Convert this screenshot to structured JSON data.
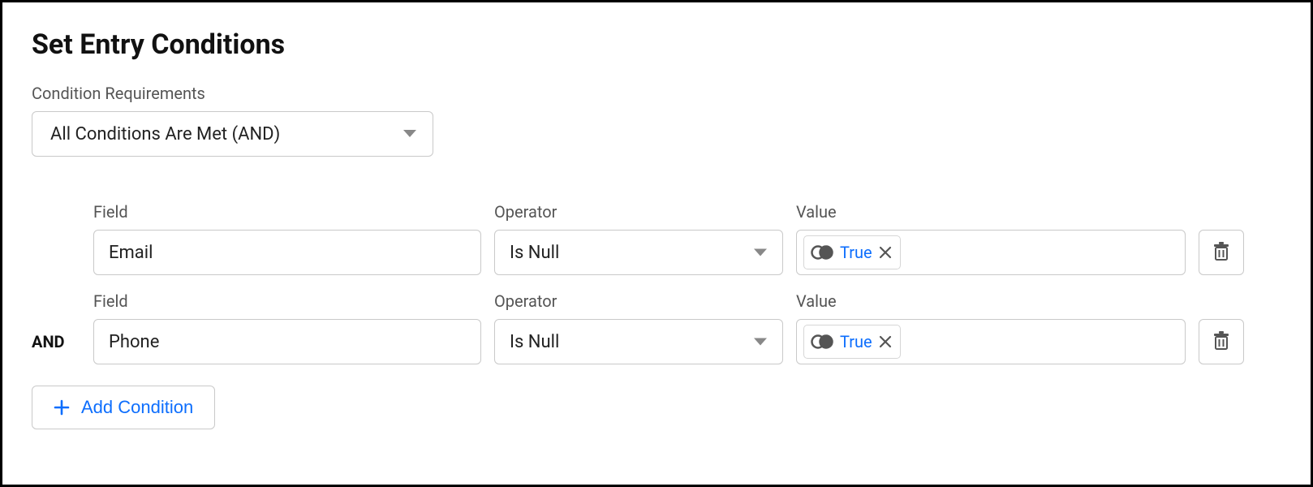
{
  "title": "Set Entry Conditions",
  "requirements": {
    "label": "Condition Requirements",
    "selected": "All Conditions Are Met (AND)"
  },
  "labels": {
    "field": "Field",
    "operator": "Operator",
    "value": "Value"
  },
  "logicOperator": "AND",
  "conditions": [
    {
      "field": "Email",
      "operator": "Is Null",
      "value": "True"
    },
    {
      "field": "Phone",
      "operator": "Is Null",
      "value": "True"
    }
  ],
  "addCondition": "Add Condition"
}
